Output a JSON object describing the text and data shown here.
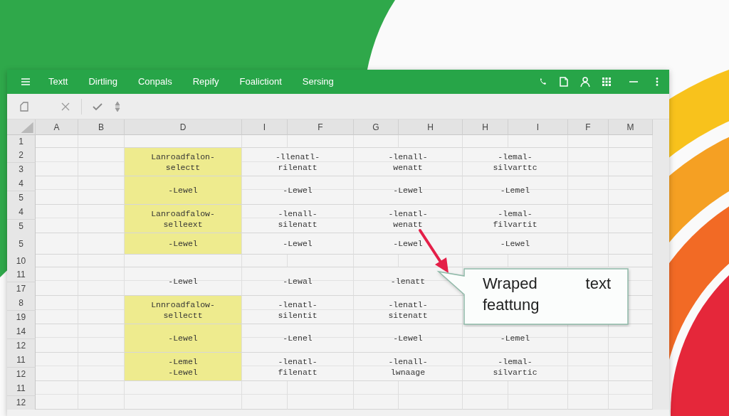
{
  "menu_bar": {
    "items": [
      {
        "label": "Textt"
      },
      {
        "label": "Dirtling"
      },
      {
        "label": "Conpals"
      },
      {
        "label": "Repify"
      },
      {
        "label": "Foalictiont"
      },
      {
        "label": "Sersing"
      }
    ]
  },
  "columns": [
    "A",
    "B",
    "D",
    "I",
    "F",
    "G",
    "H",
    "H",
    "I",
    "F",
    "M"
  ],
  "row_groups": [
    {
      "row_numbers": [
        "1"
      ]
    },
    {
      "row_numbers": [
        "2",
        "3"
      ],
      "cells": [
        {
          "lines": [
            "Lanroadfalon-",
            "selectt"
          ],
          "highlighted": true
        },
        {
          "lines": [
            "-llenatl-",
            "rilenatt"
          ],
          "highlighted": false
        },
        {
          "lines": [
            "-lenall-",
            "wenatt"
          ],
          "highlighted": false
        },
        {
          "lines": [
            "-lemal-",
            "silvarttc"
          ],
          "highlighted": false
        }
      ]
    },
    {
      "row_numbers": [
        "4",
        "5"
      ],
      "cells": [
        {
          "lines": [
            "-Lewel"
          ],
          "highlighted": true
        },
        {
          "lines": [
            "-Lewel"
          ],
          "highlighted": false
        },
        {
          "lines": [
            "-Lewel"
          ],
          "highlighted": false
        },
        {
          "lines": [
            "-Lemel"
          ],
          "highlighted": false
        }
      ]
    },
    {
      "row_numbers": [
        "4",
        "5"
      ],
      "cells": [
        {
          "lines": [
            "Lanroadfalow-",
            "selleext"
          ],
          "highlighted": true
        },
        {
          "lines": [
            "-lenall-",
            "silenatt"
          ],
          "highlighted": false
        },
        {
          "lines": [
            "-lenatl-",
            "wenatt"
          ],
          "highlighted": false
        },
        {
          "lines": [
            "-lemal-",
            "filvartit"
          ],
          "highlighted": false
        }
      ]
    },
    {
      "row_numbers": [
        "5"
      ],
      "cells": [
        {
          "lines": [
            "-Lewel"
          ],
          "highlighted": true
        },
        {
          "lines": [
            "-Lewel"
          ],
          "highlighted": false
        },
        {
          "lines": [
            "-Lewel"
          ],
          "highlighted": false
        },
        {
          "lines": [
            "-Lewel"
          ],
          "highlighted": false
        }
      ]
    },
    {
      "row_numbers": [
        "10"
      ]
    },
    {
      "row_numbers": [
        "11",
        "17"
      ],
      "cells": [
        {
          "lines": [
            "-Lewel"
          ],
          "highlighted": false
        },
        {
          "lines": [
            "-Lewal"
          ],
          "highlighted": false
        },
        {
          "lines": [
            "-lenatt"
          ],
          "highlighted": false
        }
      ]
    },
    {
      "row_numbers": [
        "8",
        "19"
      ],
      "cells": [
        {
          "lines": [
            "Lnnroadfalow-",
            "sellectt"
          ],
          "highlighted": true
        },
        {
          "lines": [
            "-lenatl-",
            "silentit"
          ],
          "highlighted": false
        },
        {
          "lines": [
            "-lenatl-",
            "sitenatt"
          ],
          "highlighted": false
        }
      ]
    },
    {
      "row_numbers": [
        "14",
        "12"
      ],
      "cells": [
        {
          "lines": [
            "-Lewel"
          ],
          "highlighted": true
        },
        {
          "lines": [
            "-Lenel"
          ],
          "highlighted": false
        },
        {
          "lines": [
            "-Lewel"
          ],
          "highlighted": false
        },
        {
          "lines": [
            "-Lemel"
          ],
          "highlighted": false
        }
      ]
    },
    {
      "row_numbers": [
        "11",
        "12"
      ],
      "cells": [
        {
          "lines": [
            "-Lemel",
            "-Lewel"
          ],
          "highlighted": true
        },
        {
          "lines": [
            "-lenatl-",
            "filenatt"
          ],
          "highlighted": false
        },
        {
          "lines": [
            "-lenall-",
            "lwnaage"
          ],
          "highlighted": false
        },
        {
          "lines": [
            "-lemal-",
            "silvartic"
          ],
          "highlighted": false
        }
      ]
    },
    {
      "row_numbers": [
        "11",
        "12"
      ]
    }
  ],
  "callout": {
    "lines": [
      "Wraped text",
      "feattung"
    ]
  }
}
